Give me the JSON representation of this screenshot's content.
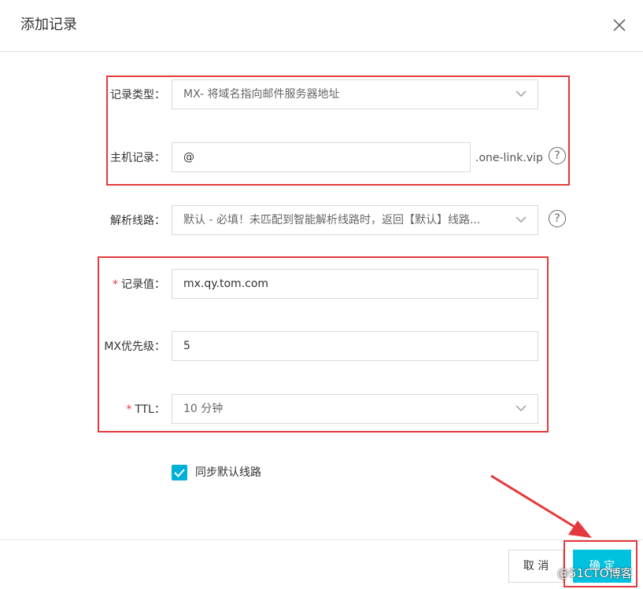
{
  "dialog": {
    "title": "添加记录"
  },
  "form": {
    "record_type": {
      "label": "记录类型：",
      "value": "MX- 将域名指向邮件服务器地址"
    },
    "host_record": {
      "label": "主机记录：",
      "value": "@",
      "suffix": ".one-link.vip"
    },
    "line": {
      "label": "解析线路：",
      "value": "默认 - 必填！未匹配到智能解析线路时，返回【默认】线路..."
    },
    "record_value": {
      "required_mark": "*",
      "label": "记录值：",
      "value": "mx.qy.tom.com"
    },
    "mx_priority": {
      "label": "MX优先级：",
      "value": "5"
    },
    "ttl": {
      "required_mark": "*",
      "label": "TTL：",
      "value": "10 分钟"
    },
    "sync_default": {
      "label": "同步默认线路",
      "checked": true
    },
    "help_glyph": "?"
  },
  "footer": {
    "cancel_label": "取 消",
    "ok_label": "确 定"
  },
  "watermark": "@51CTO博客",
  "colors": {
    "accent": "#00c1de",
    "annotation": "#e4393c",
    "border": "#d9d9d9"
  }
}
